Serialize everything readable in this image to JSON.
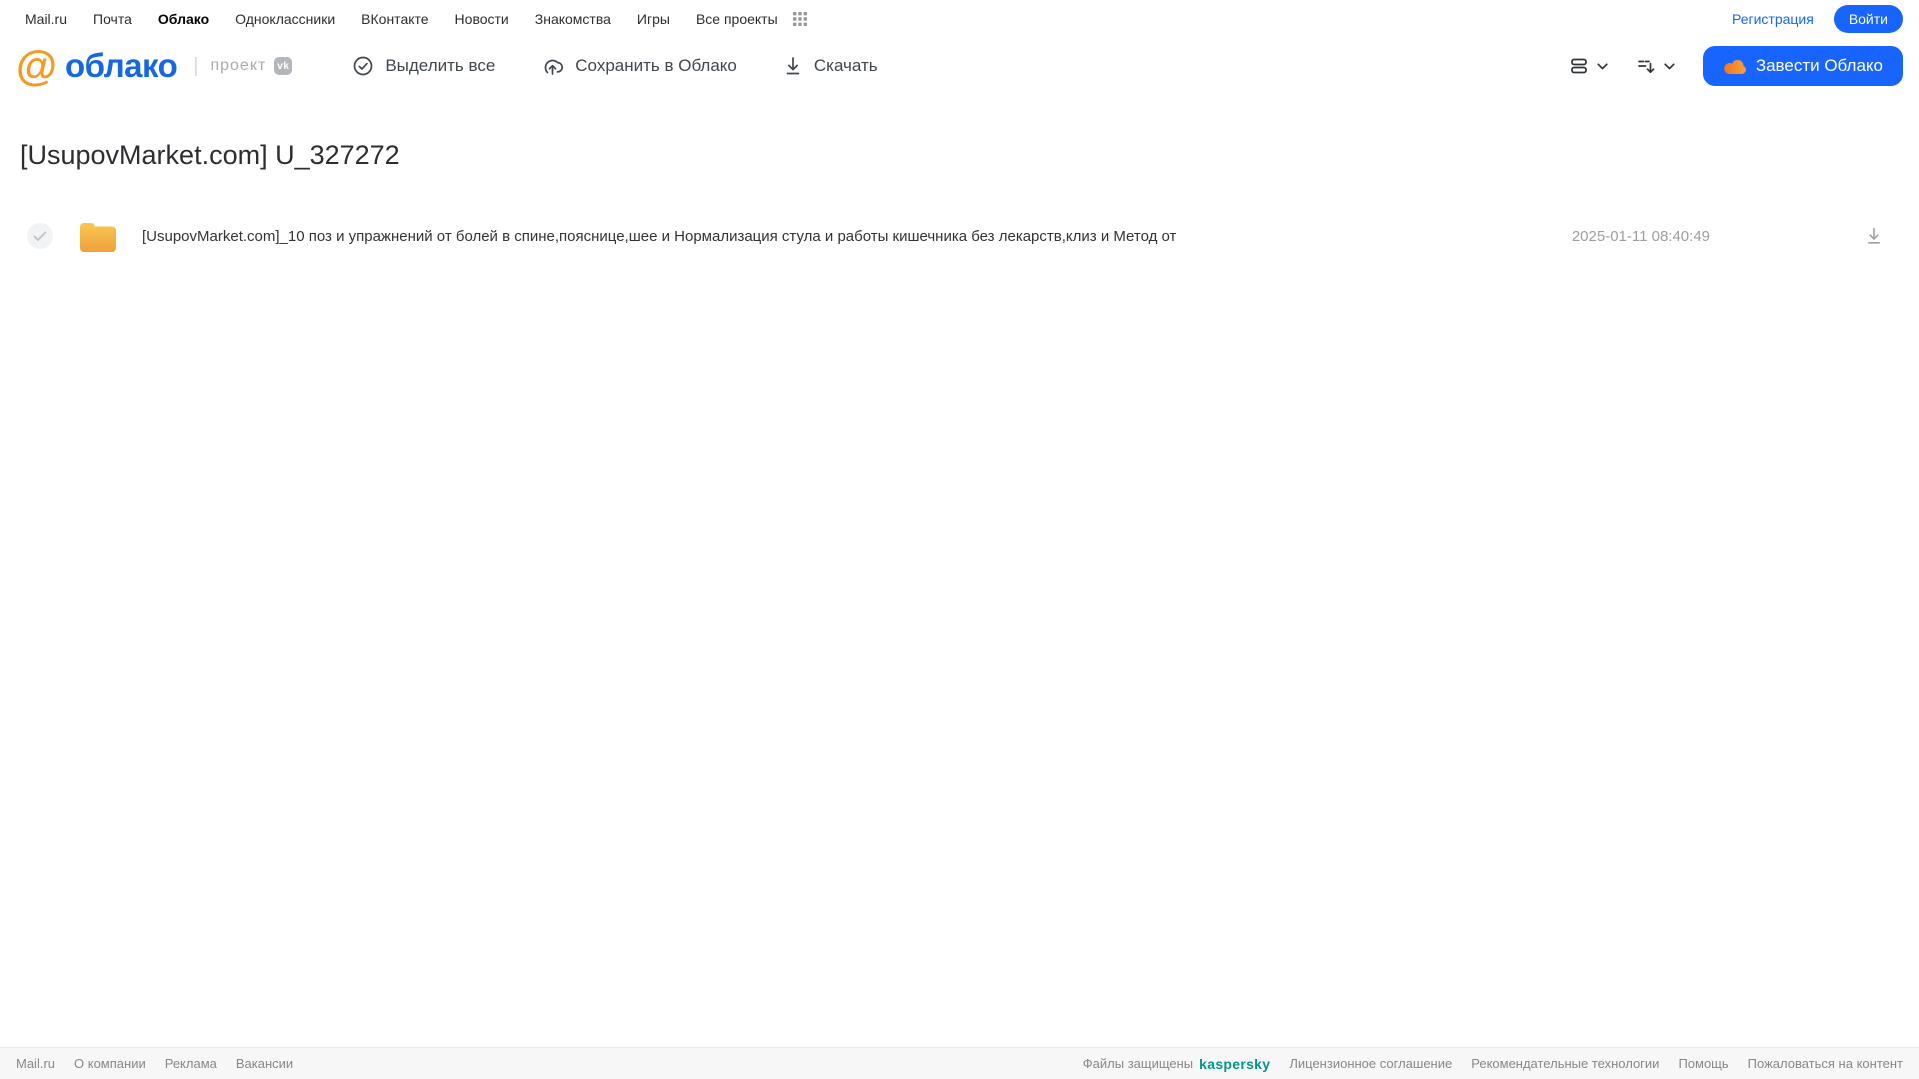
{
  "top_nav": {
    "links": [
      {
        "label": "Mail.ru"
      },
      {
        "label": "Почта"
      },
      {
        "label": "Облако",
        "bold": true
      },
      {
        "label": "Одноклассники"
      },
      {
        "label": "ВКонтакте"
      },
      {
        "label": "Новости"
      },
      {
        "label": "Знакомства"
      },
      {
        "label": "Игры"
      },
      {
        "label": "Все проекты"
      }
    ],
    "register_label": "Регистрация",
    "login_label": "Войти"
  },
  "header": {
    "logo_at": "@",
    "logo_text": "облако",
    "project_label": "проект",
    "vk_badge": "vk",
    "toolbar": {
      "select_all_label": "Выделить все",
      "save_to_cloud_label": "Сохранить в Облако",
      "download_label": "Скачать"
    },
    "cta_label": "Завести Облако"
  },
  "main": {
    "title": "[UsupovMarket.com] U_327272",
    "files": [
      {
        "name": "[UsupovMarket.com]_10 поз и упражнений от болей в спине,пояснице,шее и Нормализация стула и работы кишечника без лекарств,клиз и Метод от",
        "date": "2025-01-11 08:40:49"
      }
    ]
  },
  "footer": {
    "left_links": [
      "Mail.ru",
      "О компании",
      "Реклама",
      "Вакансии"
    ],
    "protected_text": "Файлы защищены",
    "kaspersky_label": "kaspersky",
    "right_links": [
      "Лицензионное соглашение",
      "Рекомендательные технологии",
      "Помощь",
      "Пожаловаться на контент"
    ]
  },
  "colors": {
    "accent_blue": "#1764ff",
    "logo_blue": "#1766e2",
    "logo_orange": "#f7981f",
    "folder_yellow_top": "#f9c752",
    "folder_yellow_bottom": "#efa13c",
    "kaspersky_green": "#009884",
    "muted_gray": "#9b9ea3"
  },
  "icons": {
    "select_all": "check-circle",
    "save_to_cloud": "cloud-upload",
    "download": "arrow-down-line",
    "view_mode": "rows-list",
    "sort": "sort-desc",
    "apps": "grid-3x3",
    "vk": "vk-logo",
    "cta_cloud": "cloud-orange",
    "file": "folder"
  }
}
